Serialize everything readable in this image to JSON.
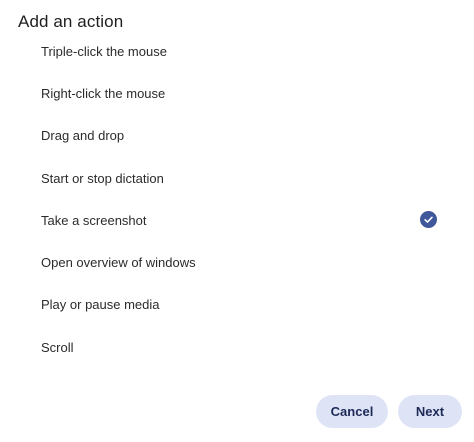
{
  "dialog": {
    "title": "Add an action"
  },
  "actions_list": {
    "items": [
      {
        "label": "Triple-click the mouse",
        "selected": false
      },
      {
        "label": "Right-click the mouse",
        "selected": false
      },
      {
        "label": "Drag and drop",
        "selected": false
      },
      {
        "label": "Start or stop dictation",
        "selected": false
      },
      {
        "label": "Take a screenshot",
        "selected": true
      },
      {
        "label": "Open overview of windows",
        "selected": false
      },
      {
        "label": "Play or pause media",
        "selected": false
      },
      {
        "label": "Scroll",
        "selected": false
      }
    ]
  },
  "footer": {
    "cancel_label": "Cancel",
    "next_label": "Next"
  },
  "colors": {
    "accent": "#3f5899",
    "button_bg": "#dfe3f6",
    "button_text": "#1d2a57"
  },
  "icons": {
    "selected": "check-circle-icon"
  }
}
